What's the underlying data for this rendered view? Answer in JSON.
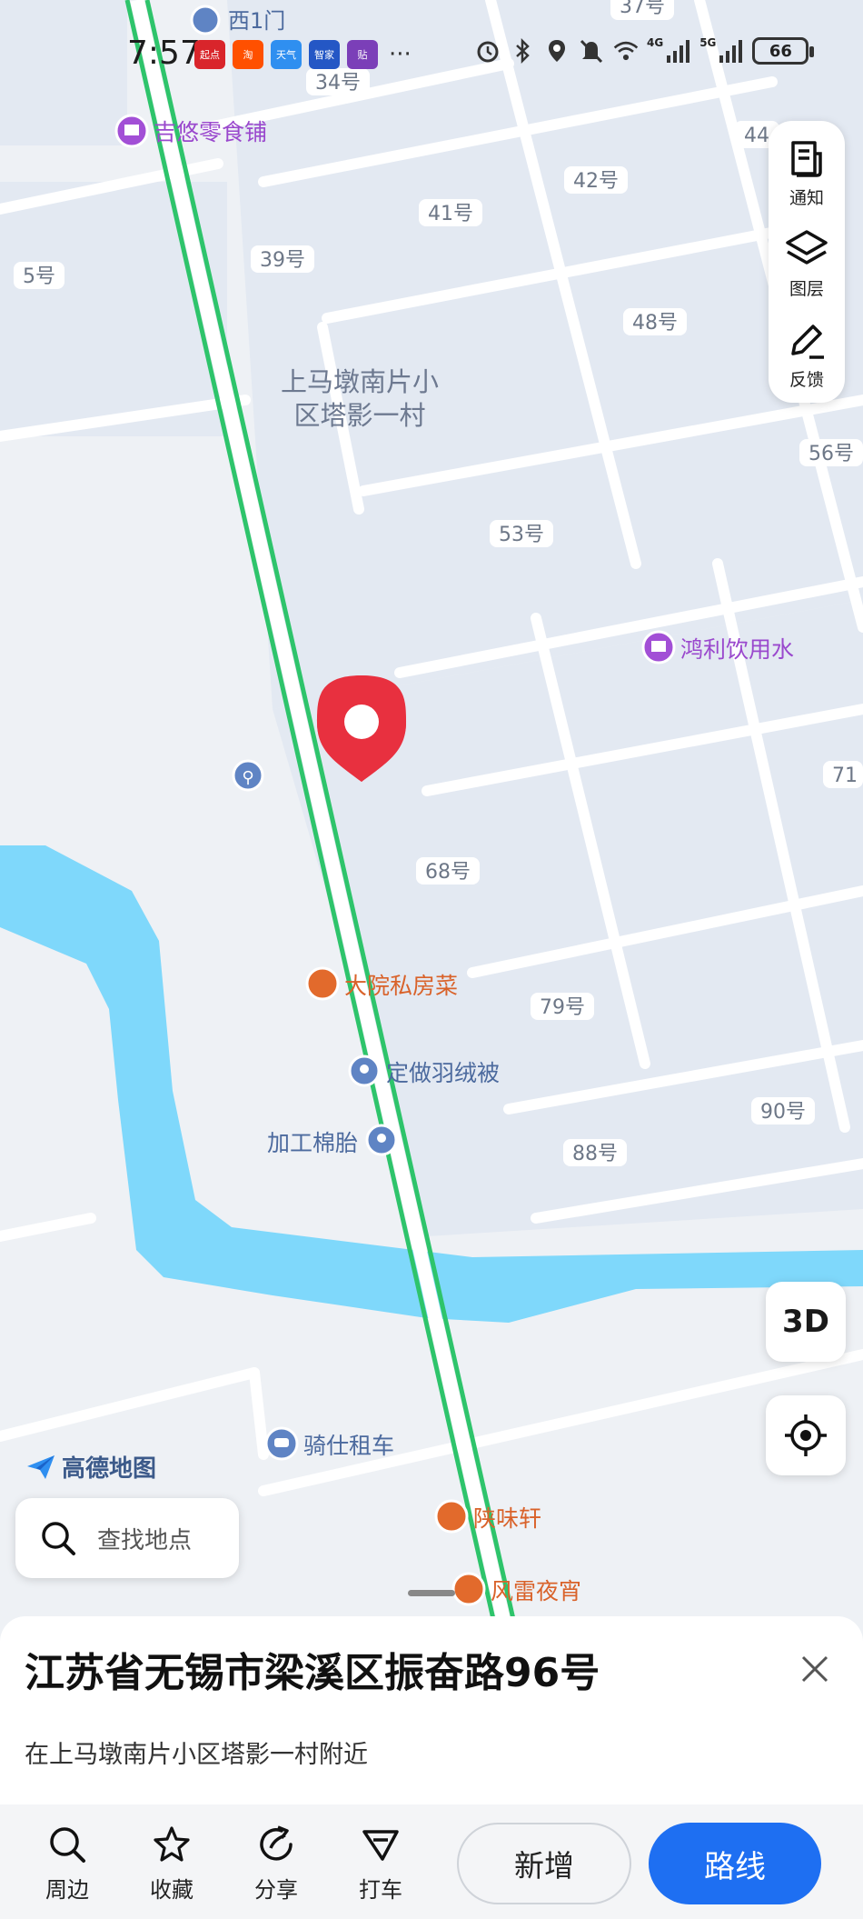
{
  "status_bar": {
    "time": "7:57",
    "app_badges": [
      {
        "text": "起点",
        "color": "#d9252b"
      },
      {
        "text": "淘",
        "color": "#ff5000"
      },
      {
        "text": "天气",
        "color": "#2f8ff0"
      },
      {
        "text": "智家",
        "color": "#2457c5"
      },
      {
        "text": "贴",
        "color": "#7b3fb8"
      }
    ],
    "more": "···",
    "network_a": "4G",
    "network_b": "5G",
    "battery": "66"
  },
  "map": {
    "road_labels": [
      {
        "text": "37号"
      },
      {
        "text": "34号"
      },
      {
        "text": "44"
      },
      {
        "text": "42号"
      },
      {
        "text": "41号"
      },
      {
        "text": "39号"
      },
      {
        "text": "5号"
      },
      {
        "text": "48号"
      },
      {
        "text": "56号"
      },
      {
        "text": "53号"
      },
      {
        "text": "71"
      },
      {
        "text": "68号"
      },
      {
        "text": "79号"
      },
      {
        "text": "90号"
      },
      {
        "text": "88号"
      }
    ],
    "area_name_line1": "上马墩南片小",
    "area_name_line2": "区塔影一村",
    "pois": {
      "gate": "西1门",
      "snack_shop": "吉悠零食铺",
      "water_shop": "鸿利饮用水",
      "restaurant": "大院私房菜",
      "duvet_shop": "定做羽绒被",
      "cotton_shop": "加工棉胎",
      "car_rental": "骑仕租车",
      "shaanxi_food": "陕味轩",
      "night_snack": "风雷夜宵"
    }
  },
  "toolbar": {
    "notify": "通知",
    "layers": "图层",
    "feedback": "反馈",
    "three_d": "3D"
  },
  "logo_text": "高德地图",
  "search": {
    "placeholder": "查找地点"
  },
  "place": {
    "address": "江苏省无锡市梁溪区振奋路96号",
    "nearby": "在上马墩南片小区塔影一村附近"
  },
  "actions": {
    "nearby": "周边",
    "favorite": "收藏",
    "share": "分享",
    "taxi": "打车",
    "add": "新增",
    "route": "路线"
  },
  "colors": {
    "river": "#7fd8fb",
    "rail": "#2ec46b",
    "pin": "#e8303f",
    "route_button": "#1e6ff2",
    "poi_purple": "#a24fd6",
    "poi_orange": "#e26a2c",
    "poi_blue": "#5f84c4"
  }
}
